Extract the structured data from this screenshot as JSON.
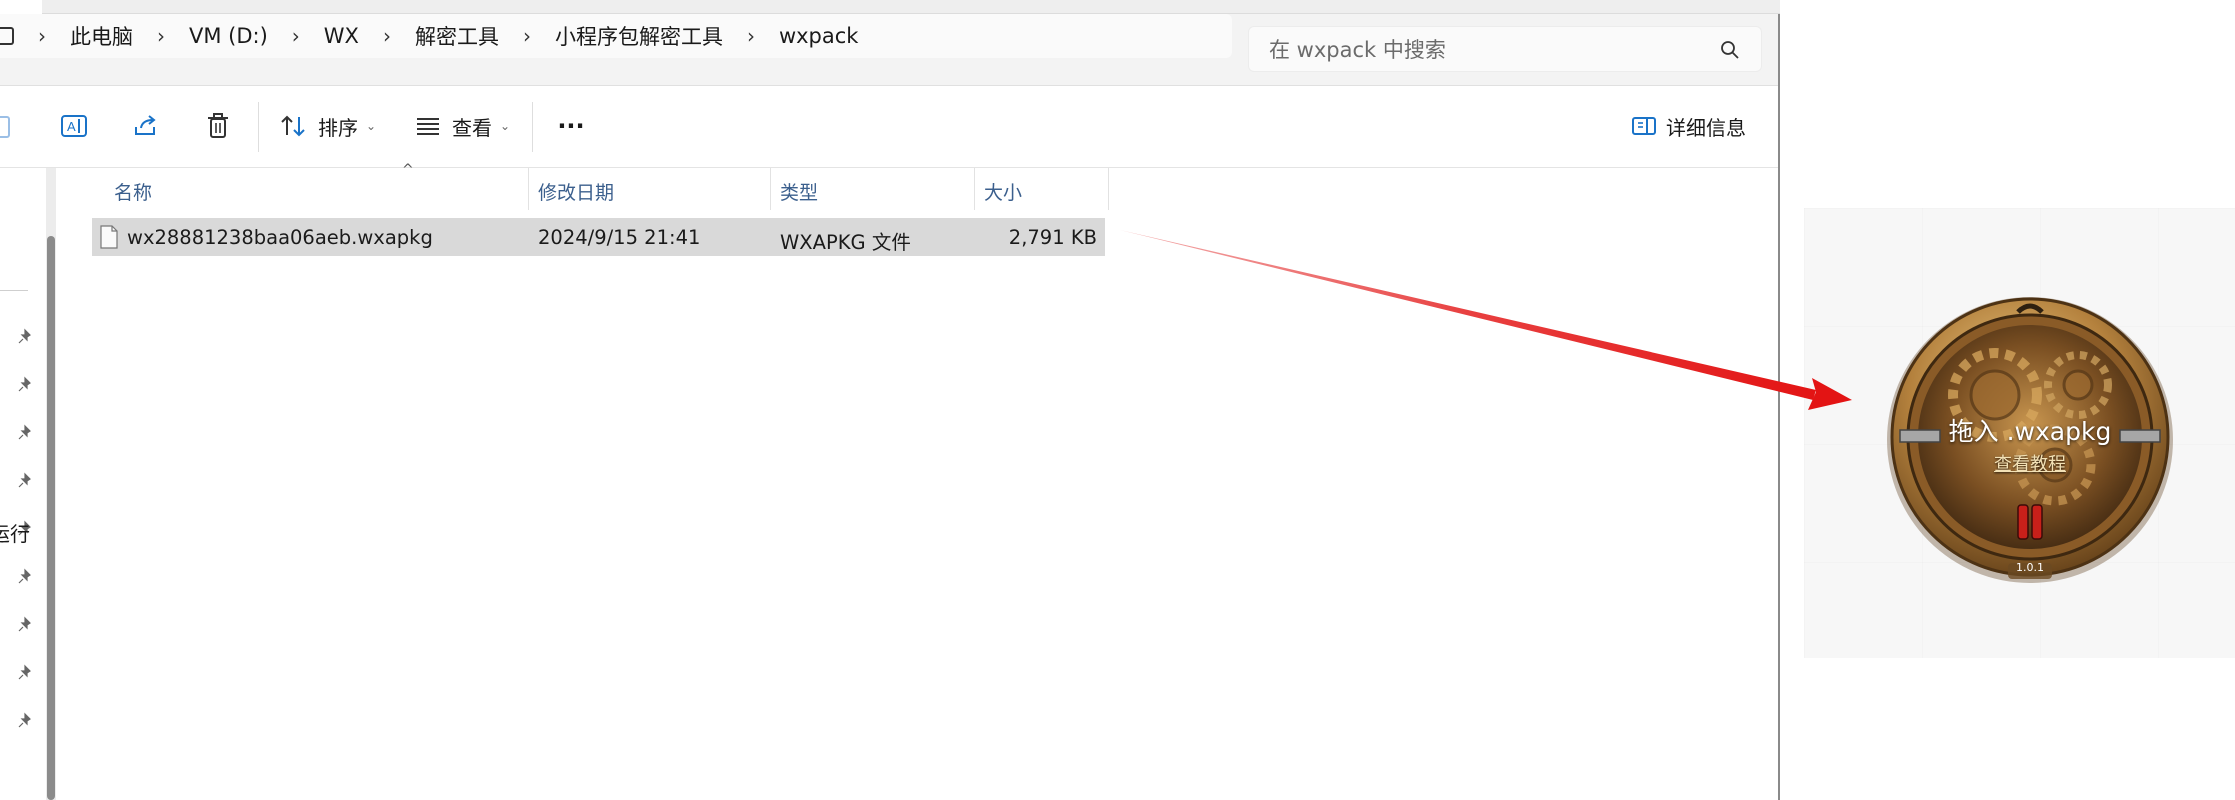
{
  "address": {
    "crumbs": [
      "此电脑",
      "VM (D:)",
      "WX",
      "解密工具",
      "小程序包解密工具",
      "wxpack"
    ]
  },
  "search": {
    "placeholder": "在 wxpack 中搜索"
  },
  "toolbar": {
    "sort_label": "排序",
    "view_label": "查看",
    "more_label": "···",
    "details_label": "详细信息"
  },
  "nav": {
    "partial_label": "运行"
  },
  "columns": {
    "name": "名称",
    "modified": "修改日期",
    "type": "类型",
    "size": "大小"
  },
  "files": [
    {
      "name": "wx28881238baa06aeb.wxapkg",
      "modified": "2024/9/15 21:41",
      "type": "WXAPKG 文件",
      "size": "2,791 KB"
    }
  ],
  "dropper": {
    "title": "拖入 .wxapkg",
    "tutorial_link": "查看教程",
    "version": "1.0.1"
  },
  "colors": {
    "arrow": "#e31414",
    "selection": "#d9d9d9",
    "accent": "#1a73c8",
    "brass": "#b07a33"
  }
}
